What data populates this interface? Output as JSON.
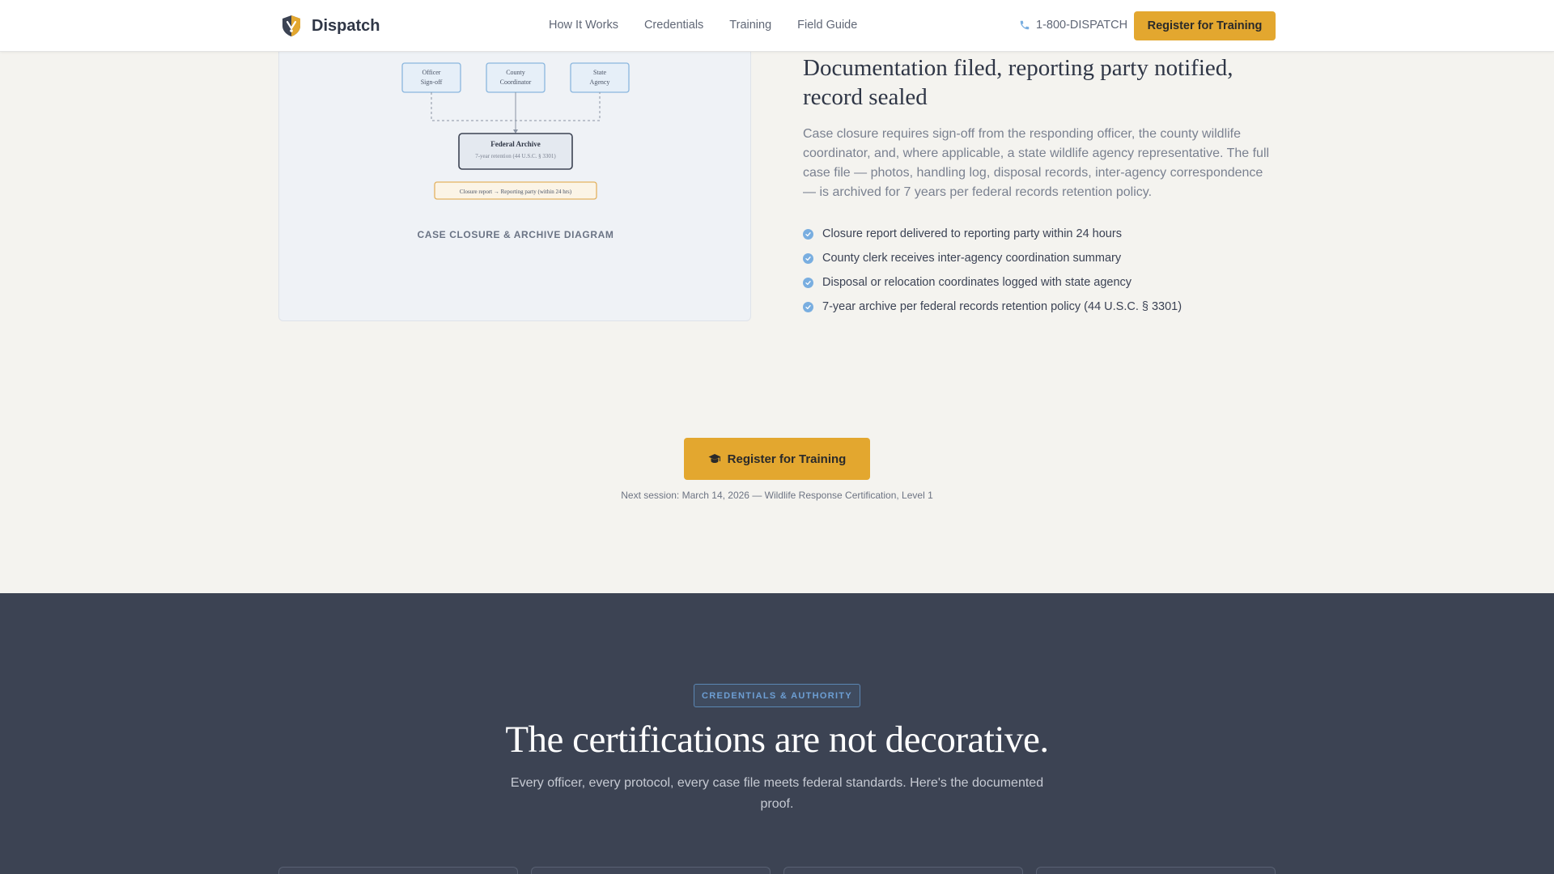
{
  "header": {
    "brand_name": "Dispatch",
    "nav": [
      "How It Works",
      "Credentials",
      "Training",
      "Field Guide"
    ],
    "phone": "1-800-DISPATCH",
    "cta_label": "Register for Training"
  },
  "diagram": {
    "boxes": {
      "officer": [
        "Officer",
        "Sign-off"
      ],
      "county": [
        "County",
        "Coordinator"
      ],
      "state": [
        "State",
        "Agency"
      ],
      "archive_title": "Federal Archive",
      "archive_sub": "7-year retention (44 U.S.C. § 3301)",
      "report": "Closure report → Reporting party (within 24 hrs)"
    },
    "caption": "CASE CLOSURE & ARCHIVE DIAGRAM"
  },
  "closure": {
    "title": "Documentation filed, reporting party notified, record sealed",
    "description": "Case closure requires sign-off from the responding officer, the county wildlife coordinator, and, where applicable, a state wildlife agency representative. The full case file — photos, handling log, disposal records, inter-agency correspondence — is archived for 7 years per federal records retention policy.",
    "checklist": [
      "Closure report delivered to reporting party within 24 hours",
      "County clerk receives inter-agency coordination summary",
      "Disposal or relocation coordinates logged with state agency",
      "7-year archive per federal records retention policy (44 U.S.C. § 3301)"
    ]
  },
  "cta": {
    "label": "Register for Training",
    "next_session": "Next session: March 14, 2026 — Wildlife Response Certification, Level 1"
  },
  "credentials": {
    "badge": "CREDENTIALS & AUTHORITY",
    "title": "The certifications are not decorative.",
    "subtitle": "Every officer, every protocol, every case file meets federal standards. Here's the documented proof."
  },
  "colors": {
    "accent": "#e3a72f",
    "dark_bg": "#3c4353",
    "check_blue": "#79aee0",
    "box_blue": "#8ab6de"
  },
  "icons": {
    "brand": "shield-icon",
    "phone": "phone-icon",
    "check": "check-circle-icon",
    "cta": "graduation-cap-icon"
  }
}
